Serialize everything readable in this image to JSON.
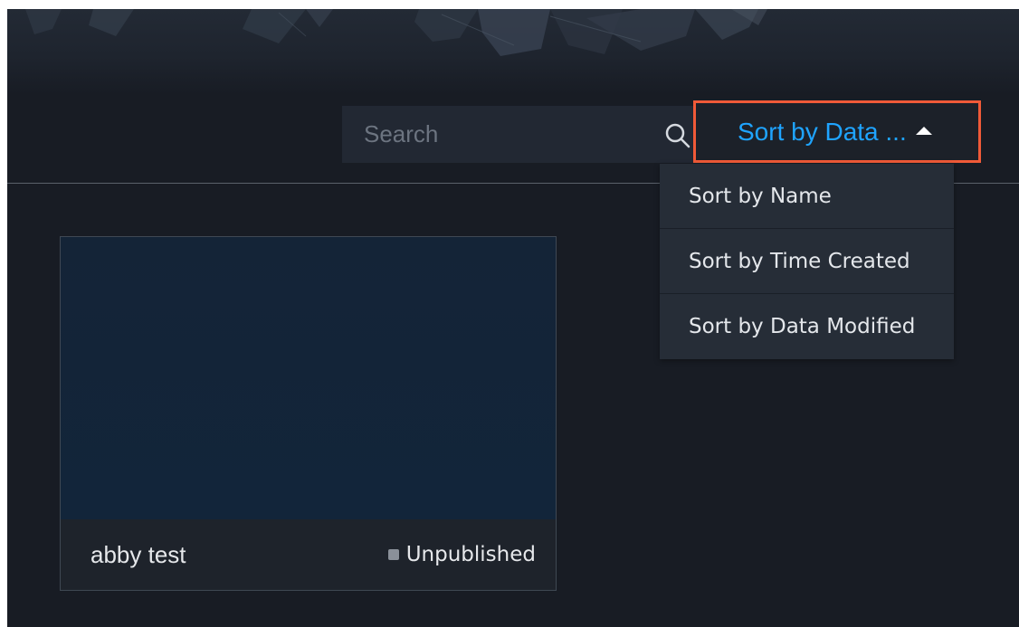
{
  "search": {
    "placeholder": "Search"
  },
  "sort": {
    "current_label": "Sort by Data ...",
    "options": [
      {
        "label": "Sort by Name"
      },
      {
        "label": "Sort by Time Created"
      },
      {
        "label": "Sort by Data Modified"
      }
    ]
  },
  "projects": [
    {
      "title": "abby test",
      "status": "Unpublished"
    }
  ],
  "colors": {
    "accent": "#1fa4ff",
    "highlight_border": "#f05a38",
    "background": "#181c24",
    "status_dot": "#8a9099"
  }
}
